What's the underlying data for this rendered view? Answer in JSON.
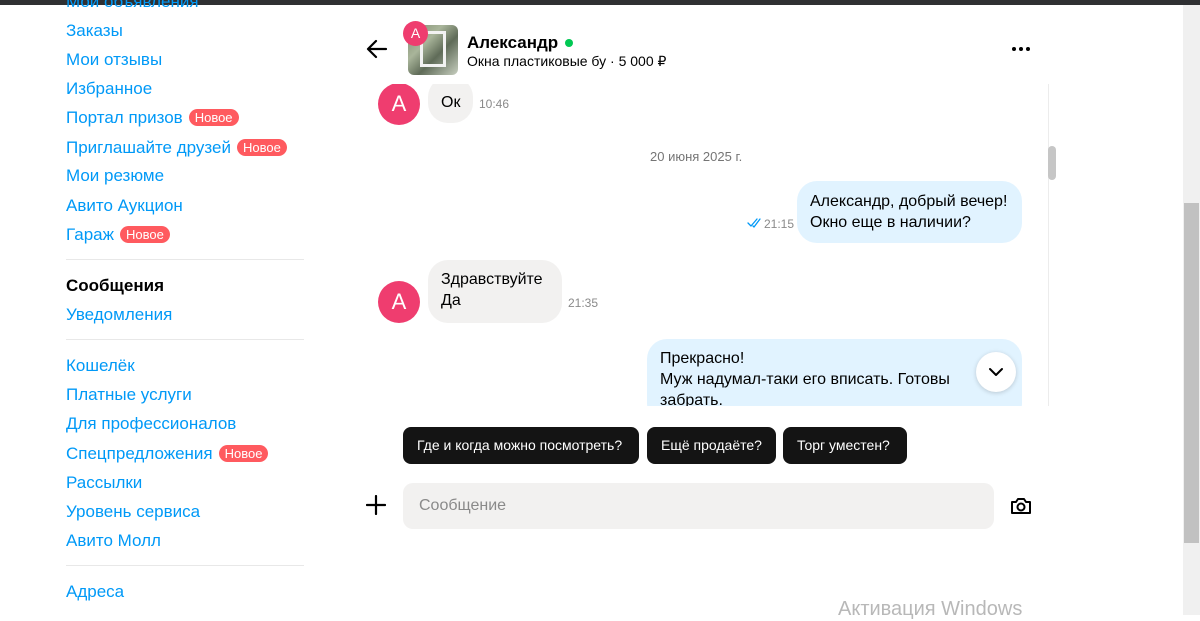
{
  "sidebar": {
    "items": [
      {
        "label": "Мои объявления"
      },
      {
        "label": "Заказы"
      },
      {
        "label": "Мои отзывы"
      },
      {
        "label": "Избранное"
      },
      {
        "label": "Портал призов",
        "badge": "Новое"
      },
      {
        "label": "Приглашайте друзей",
        "badge": "Новое"
      },
      {
        "label": "Мои резюме"
      },
      {
        "label": "Авито Аукцион"
      },
      {
        "label": "Гараж",
        "badge": "Новое"
      },
      {
        "label": "Сообщения"
      },
      {
        "label": "Уведомления"
      },
      {
        "label": "Кошелёк"
      },
      {
        "label": "Платные услуги"
      },
      {
        "label": "Для профессионалов"
      },
      {
        "label": "Спецпредложения",
        "badge": "Новое"
      },
      {
        "label": "Рассылки"
      },
      {
        "label": "Уровень сервиса"
      },
      {
        "label": "Авито Молл"
      },
      {
        "label": "Адреса"
      }
    ]
  },
  "chat": {
    "avatar_letter": "А",
    "contact_name": "Александр",
    "status": "online",
    "listing": "Окна пластиковые бу · 5 000 ₽",
    "date_separator": "20 июня 2025 г.",
    "messages": [
      {
        "direction": "in",
        "text": "Ок",
        "time": "10:46"
      },
      {
        "direction": "out",
        "lines": [
          "Александр, добрый вечер!",
          "Окно еще в наличии?"
        ],
        "time": "21:15",
        "status": "read"
      },
      {
        "direction": "in",
        "lines": [
          "Здравствуйте",
          "Да"
        ],
        "time": "21:35"
      },
      {
        "direction": "out",
        "lines": [
          "Прекрасно!",
          "Муж надумал-таки его вписать. Готовы",
          "забрать."
        ]
      }
    ]
  },
  "quick_replies": [
    "Где и когда можно посмотреть?",
    "Ещё продаёте?",
    "Торг уместен?"
  ],
  "composer": {
    "placeholder": "Сообщение"
  },
  "watermark": "Активация Windows",
  "colors": {
    "link": "#0099f7",
    "badge": "#ff5a5f",
    "avatar": "#ef3d6f",
    "online": "#00c853",
    "incoming_bubble": "#f2f1f0",
    "outgoing_bubble": "#e1f3ff",
    "quick_reply": "#141414"
  }
}
